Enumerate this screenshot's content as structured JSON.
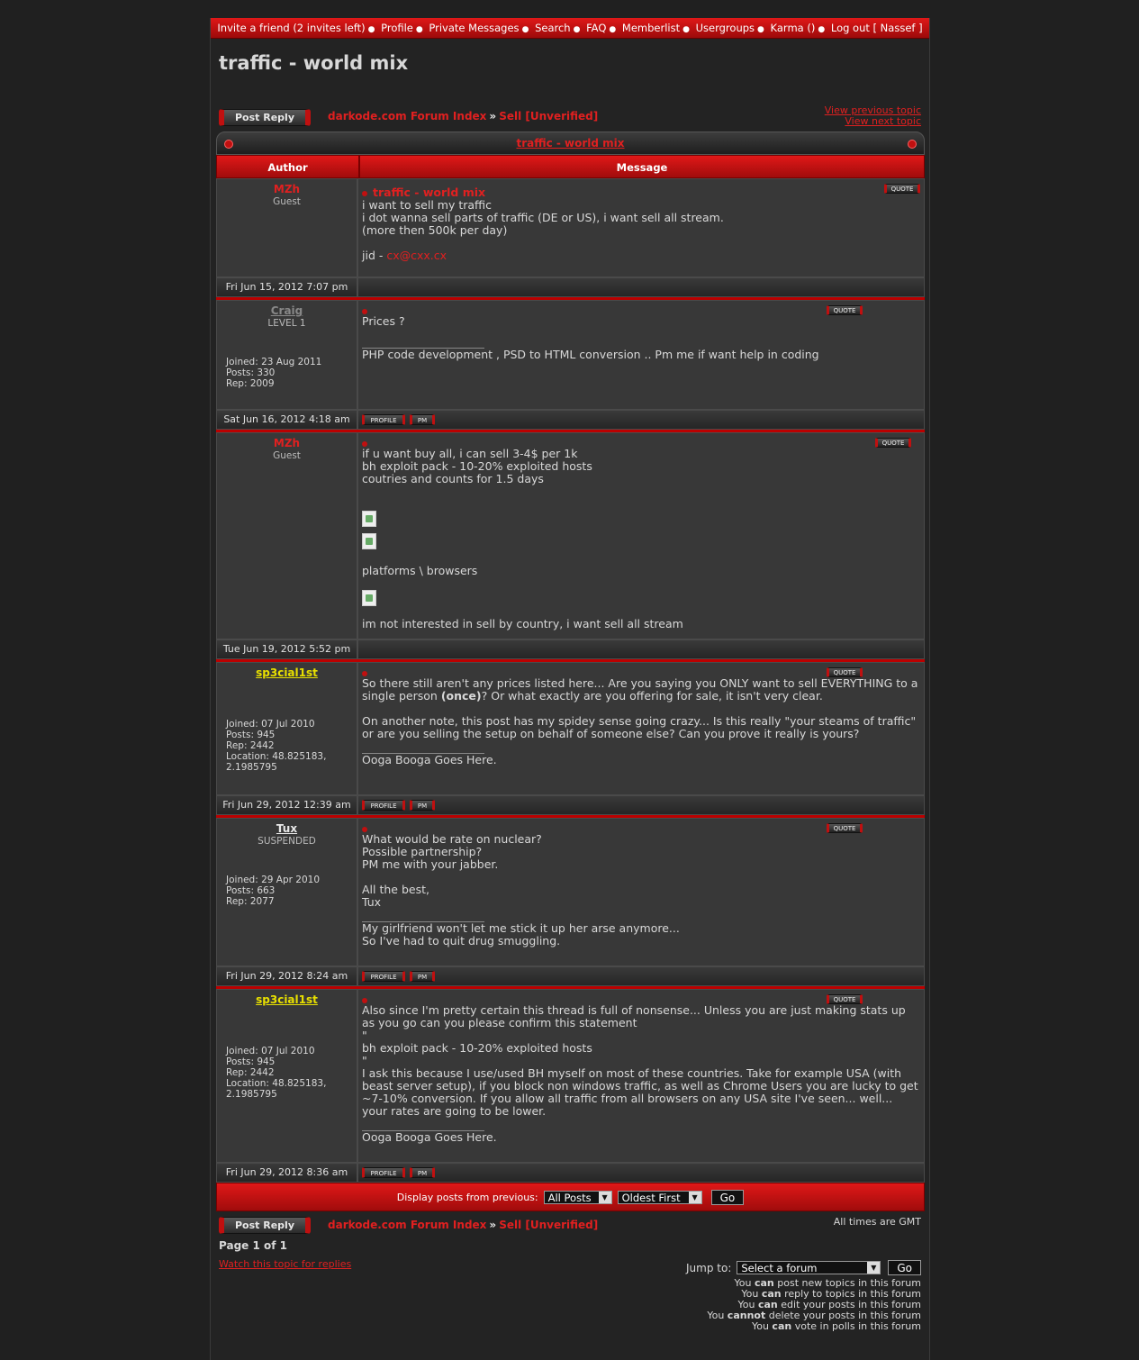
{
  "nav": [
    "Invite a friend (2 invites left)",
    "Profile",
    "Private Messages",
    "Search",
    "FAQ",
    "Memberlist",
    "Usergroups",
    "Karma ()",
    "Log out [ Nassef ]"
  ],
  "page_title": "traffic - world mix",
  "buttons": {
    "post_reply": "Post Reply",
    "go": "Go",
    "quote": "QUOTE",
    "profile": "PROFILE",
    "pm": "PM"
  },
  "breadcrumb": {
    "forum_index": "darkode.com Forum Index",
    "forum": "Sell [Unverified]"
  },
  "topic_nav": {
    "previous": "View previous topic",
    "next": "View next topic"
  },
  "table": {
    "title": "traffic - world mix",
    "col_author": "Author",
    "col_message": "Message"
  },
  "posts": [
    {
      "author": "MZh",
      "rank": "Guest",
      "subject": "traffic - world mix",
      "lines": [
        "i want to sell my traffic",
        "i dot wanna sell parts of traffic (DE or US), i want sell all stream.",
        "(more then 500k per day)"
      ],
      "jid_label": "jid - ",
      "jid_value": "cx@cxx.cx",
      "date": "Fri Jun 15, 2012 7:07 pm"
    },
    {
      "author": "Craig",
      "rank": "LEVEL 1",
      "joined": "Joined: 23 Aug 2011",
      "posts": "Posts: 330",
      "rep": "Rep: 2009",
      "text": "Prices ?",
      "signature": "PHP code development , PSD to HTML conversion .. Pm me if want help in coding",
      "date": "Sat Jun 16, 2012 4:18 am"
    },
    {
      "author": "MZh",
      "rank": "Guest",
      "lines": [
        "if u want buy all, i can sell 3-4$ per 1k",
        "bh exploit pack - 10-20% exploited hosts",
        "coutries and counts for 1.5 days"
      ],
      "platforms": "platforms \\ browsers",
      "last": "im not interested in sell by country, i want sell all stream",
      "date": "Tue Jun 19, 2012 5:52 pm"
    },
    {
      "author": "sp3cial1st",
      "joined": "Joined: 07 Jul 2010",
      "posts": "Posts: 945",
      "rep": "Rep: 2442",
      "location": "Location: 48.825183,",
      "location2": "2.1985795",
      "p1a": "So there still aren't any prices listed here... Are you saying you ONLY want to sell EVERYTHING to a single person ",
      "p1b": "(once)",
      "p1c": "? Or what exactly are you offering for sale, it isn't very clear.",
      "p2": "On another note, this post has my spidey sense going crazy... Is this really \"your steams of traffic\" or are you selling the setup on behalf of someone else? Can you prove it really is yours?",
      "signature": "Ooga Booga Goes Here.",
      "date": "Fri Jun 29, 2012 12:39 am"
    },
    {
      "author": "Tux",
      "rank": "SUSPENDED",
      "joined": "Joined: 29 Apr 2010",
      "posts": "Posts: 663",
      "rep": "Rep: 2077",
      "lines": [
        "What would be rate on nuclear?",
        "Possible partnership?",
        "PM me with your jabber."
      ],
      "closing": [
        "All the best,",
        "Tux"
      ],
      "signature": [
        "My girlfriend won't let me stick it up her arse anymore...",
        "So I've had to quit drug smuggling."
      ],
      "date": "Fri Jun 29, 2012 8:24 am"
    },
    {
      "author": "sp3cial1st",
      "joined": "Joined: 07 Jul 2010",
      "posts": "Posts: 945",
      "rep": "Rep: 2442",
      "location": "Location: 48.825183,",
      "location2": "2.1985795",
      "p1": "Also since I'm pretty certain this thread is full of nonsense... Unless you are just making stats up as you go can you please confirm this statement",
      "q1": "\"",
      "quote": "bh exploit pack - 10-20% exploited hosts",
      "q2": "\"",
      "p2": "I ask this because I use/used BH myself on most of these countries. Take for example USA (with beast server setup), if you block non windows traffic, as well as Chrome Users you are lucky to get ~7-10% conversion. If you allow all traffic from all browsers on any USA site I've seen... well... your rates are going to be lower.",
      "signature": "Ooga Booga Goes Here.",
      "date": "Fri Jun 29, 2012 8:36 am"
    }
  ],
  "display_bar": {
    "label": "Display posts from previous:",
    "period": "All Posts",
    "order": "Oldest First"
  },
  "times": "All times are GMT",
  "page_info": "Page 1 of 1",
  "watch": "Watch this topic for replies",
  "jump": {
    "label": "Jump to:",
    "placeholder": "Select a forum"
  },
  "permissions": [
    {
      "a": "You ",
      "b": "can",
      "c": " post new topics in this forum"
    },
    {
      "a": "You ",
      "b": "can",
      "c": " reply to topics in this forum"
    },
    {
      "a": "You ",
      "b": "can",
      "c": " edit your posts in this forum"
    },
    {
      "a": "You ",
      "b": "cannot",
      "c": " delete your posts in this forum"
    },
    {
      "a": "You ",
      "b": "can",
      "c": " vote in polls in this forum"
    }
  ],
  "colors": {
    "accent": "#e02020",
    "background": "#202020",
    "panel": "#383838"
  }
}
